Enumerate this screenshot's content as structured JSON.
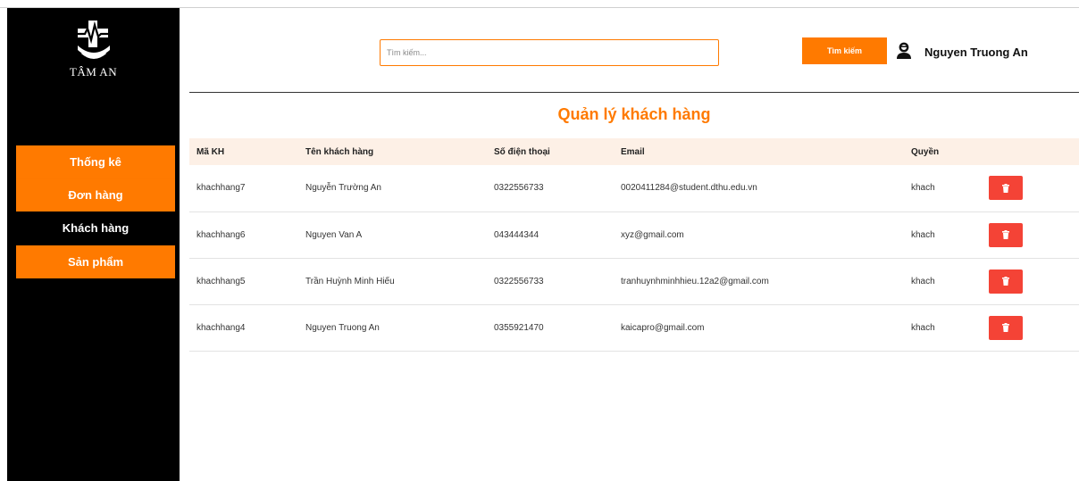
{
  "sidebar": {
    "logo_text": "TÂM AN",
    "items": [
      {
        "label": "Thống kê"
      },
      {
        "label": "Đơn hàng"
      },
      {
        "label": "Khách hàng"
      },
      {
        "label": "Sản phẩm"
      }
    ]
  },
  "header": {
    "search_placeholder": "Tìm kiếm...",
    "search_button": "Tìm kiếm",
    "user_name": "Nguyen Truong An"
  },
  "main": {
    "title": "Quản lý khách hàng",
    "columns": [
      "Mã KH",
      "Tên khách hàng",
      "Số điện thoại",
      "Email",
      "Quyền"
    ],
    "rows": [
      {
        "id": "khachhang7",
        "name": "Nguyễn Trường An",
        "phone": "0322556733",
        "email": "0020411284@student.dthu.edu.vn",
        "role": "khach"
      },
      {
        "id": "khachhang6",
        "name": "Nguyen Van A",
        "phone": "043444344",
        "email": "xyz@gmail.com",
        "role": "khach"
      },
      {
        "id": "khachhang5",
        "name": "Trần Huỳnh Minh Hiếu",
        "phone": "0322556733",
        "email": "tranhuynhminhhieu.12a2@gmail.com",
        "role": "khach"
      },
      {
        "id": "khachhang4",
        "name": "Nguyen Truong An",
        "phone": "0355921470",
        "email": "kaicapro@gmail.com",
        "role": "khach"
      }
    ]
  },
  "colors": {
    "accent": "#ff7a00",
    "delete": "#f44336",
    "sidebar_bg": "#000000",
    "header_row_bg": "#fdf0e6"
  },
  "icons": {
    "logo": "medical-cross-hand-icon",
    "user": "user-icon",
    "delete": "trash-icon"
  }
}
